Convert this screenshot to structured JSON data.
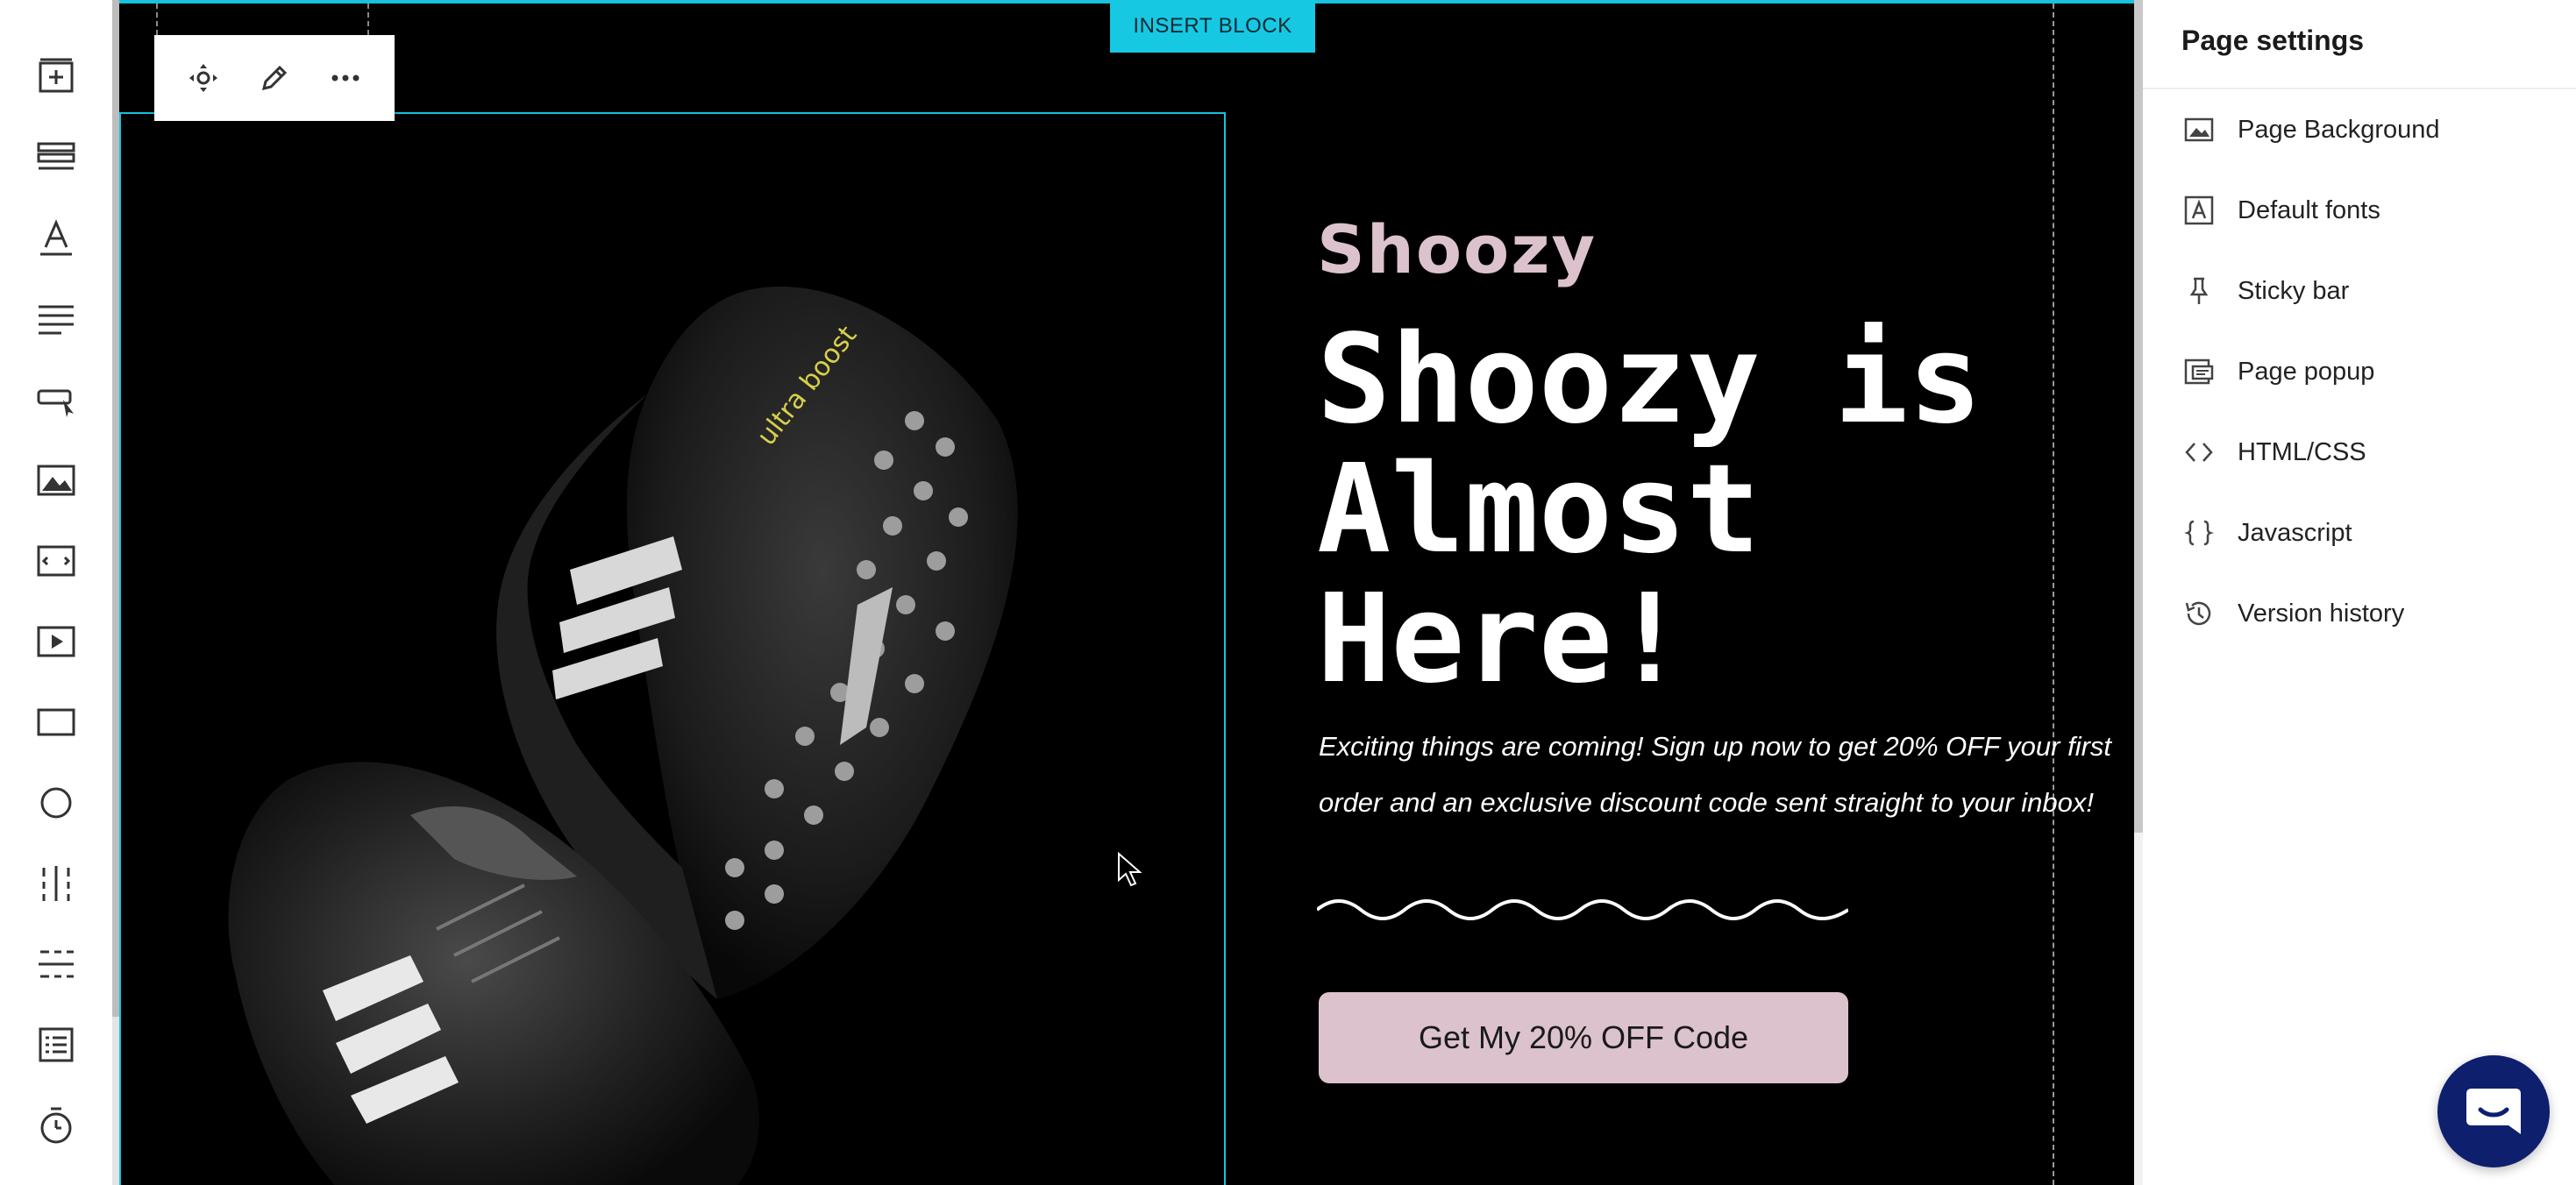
{
  "toolbar_tools": [
    {
      "icon": "add-section-icon"
    },
    {
      "icon": "rows-icon"
    },
    {
      "icon": "text-icon"
    },
    {
      "icon": "paragraph-icon"
    },
    {
      "icon": "button-icon"
    },
    {
      "icon": "image-icon"
    },
    {
      "icon": "embed-icon"
    },
    {
      "icon": "video-icon"
    },
    {
      "icon": "rectangle-icon"
    },
    {
      "icon": "circle-icon"
    },
    {
      "icon": "vertical-divider-icon"
    },
    {
      "icon": "horizontal-divider-icon"
    },
    {
      "icon": "form-icon"
    },
    {
      "icon": "timer-icon"
    }
  ],
  "canvas": {
    "insert_block_label": "INSERT BLOCK",
    "block_toolbar": [
      "move-icon",
      "edit-icon",
      "more-icon"
    ],
    "brand": "Shoozy",
    "headline": "Shoozy is Almost Here!",
    "subtext": "Exciting things are coming! Sign up now to get 20% OFF your first order and an exclusive discount code sent straight to your inbox!",
    "cta_label": "Get My 20% OFF Code",
    "colors": {
      "accent": "#dcc2cc",
      "selection": "#19c2dc",
      "background": "#000000"
    }
  },
  "panel": {
    "title": "Page settings",
    "items": [
      {
        "label": "Page Background",
        "icon": "image-icon"
      },
      {
        "label": "Default fonts",
        "icon": "font-icon"
      },
      {
        "label": "Sticky bar",
        "icon": "pin-icon"
      },
      {
        "label": "Page popup",
        "icon": "popup-icon"
      },
      {
        "label": "HTML/CSS",
        "icon": "code-icon"
      },
      {
        "label": "Javascript",
        "icon": "braces-icon"
      },
      {
        "label": "Version history",
        "icon": "history-icon"
      }
    ]
  }
}
